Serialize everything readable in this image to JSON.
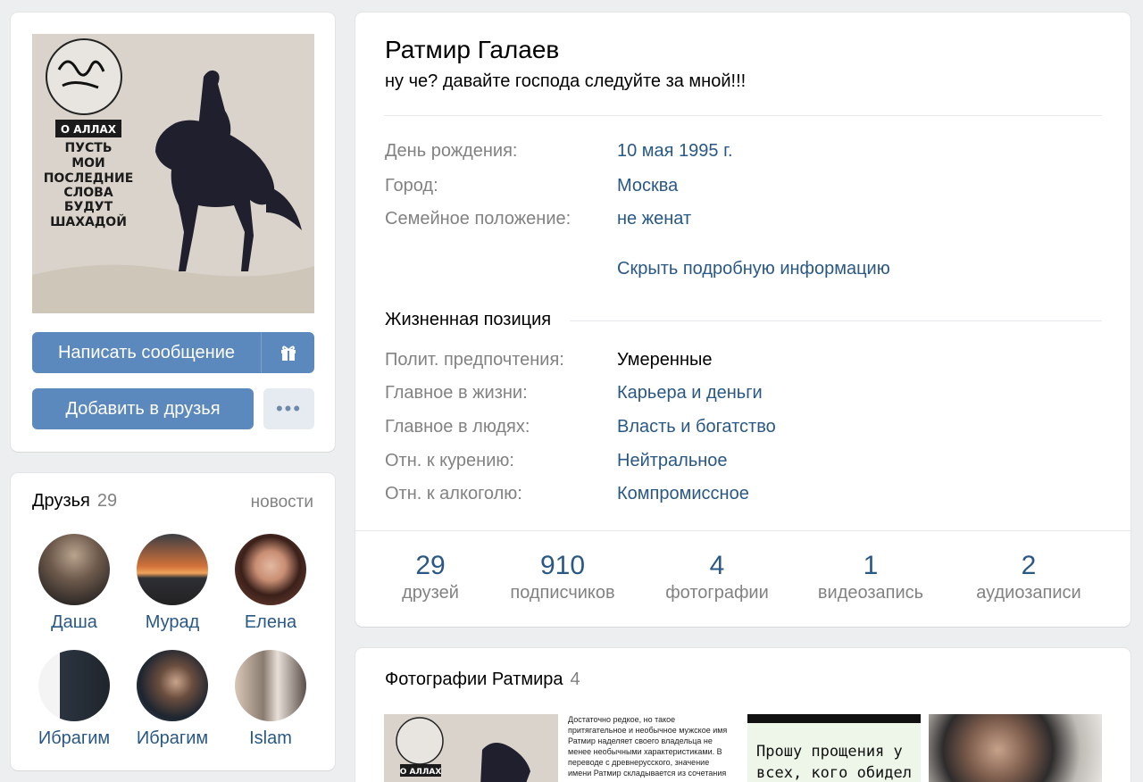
{
  "avatar": {
    "poster_lines": [
      "О АЛЛАХ",
      "ПУСТЬ",
      "МОИ",
      "ПОСЛЕДНИЕ",
      "СЛОВА",
      "БУДУТ",
      "ШАХАДОЙ"
    ]
  },
  "actions": {
    "message_label": "Написать сообщение",
    "add_friend_label": "Добавить в друзья"
  },
  "friends": {
    "title": "Друзья",
    "count": "29",
    "news_link": "новости",
    "items": [
      {
        "name": "Даша"
      },
      {
        "name": "Мурад"
      },
      {
        "name": "Елена"
      },
      {
        "name": "Ибрагим"
      },
      {
        "name": "Ибрагим"
      },
      {
        "name": "Islam"
      }
    ]
  },
  "profile": {
    "name": "Ратмир Галаев",
    "status": "ну че? давайте господа следуйте за мной!!!",
    "info": [
      {
        "label": "День рождения:",
        "value": "10 мая 1995 г."
      },
      {
        "label": "Город:",
        "value": "Москва"
      },
      {
        "label": "Семейное положение:",
        "value": "не женат"
      }
    ],
    "hide_details": "Скрыть подробную информацию",
    "life_section_title": "Жизненная позиция",
    "life": [
      {
        "label": "Полит. предпочтения:",
        "value": "Умеренные"
      },
      {
        "label": "Главное в жизни:",
        "value": "Карьера и деньги"
      },
      {
        "label": "Главное в людях:",
        "value": "Власть и богатство"
      },
      {
        "label": "Отн. к курению:",
        "value": "Нейтральное"
      },
      {
        "label": "Отн. к алкоголю:",
        "value": "Компромиссное"
      }
    ],
    "counters": [
      {
        "num": "29",
        "caption": "друзей"
      },
      {
        "num": "910",
        "caption": "подписчиков"
      },
      {
        "num": "4",
        "caption": "фотографии"
      },
      {
        "num": "1",
        "caption": "видеозапись"
      },
      {
        "num": "2",
        "caption": "аудиозаписи"
      }
    ]
  },
  "photos": {
    "title": "Фотографии Ратмира",
    "count": "4",
    "thumb2_text": "Достаточно редкое, но такое притягательное и необычное мужское имя Ратмир наделяет своего владельца не менее необычными характеристиками. В переводе с древнерусского, значение имени Ратмир складывается из сочетания",
    "thumb3_text": "Прошу прощения у всех, кого обидел"
  },
  "colors": {
    "link": "#2a5885",
    "button": "#5b88bd",
    "page_bg": "#edeef0"
  }
}
